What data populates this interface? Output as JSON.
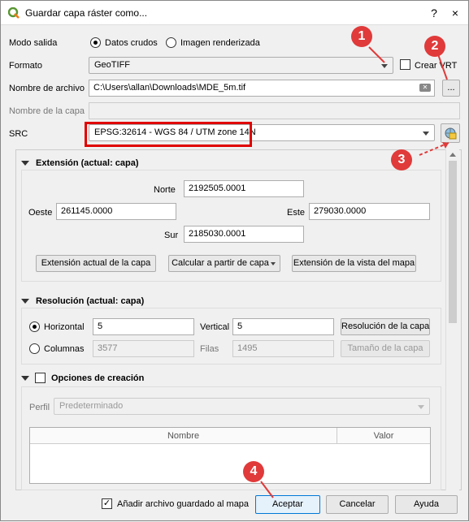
{
  "window": {
    "title": "Guardar capa ráster como...",
    "help_glyph": "?",
    "close_glyph": "×"
  },
  "output_mode": {
    "label": "Modo salida",
    "option1": "Datos crudos",
    "option2": "Imagen renderizada",
    "selected": "Datos crudos"
  },
  "format": {
    "label": "Formato",
    "value": "GeoTIFF",
    "vrt_label": "Crear VRT",
    "vrt_checked": false
  },
  "filename": {
    "label": "Nombre de archivo",
    "value": "C:\\Users\\allan\\Downloads\\MDE_5m.tif",
    "browse_label": "..."
  },
  "layer_name": {
    "label": "Nombre de la capa",
    "value": ""
  },
  "crs": {
    "label": "SRC",
    "value": "EPSG:32614 - WGS 84 / UTM zone 14N"
  },
  "extent": {
    "title": "Extensión (actual: capa)",
    "north_label": "Norte",
    "north": "2192505.0001",
    "west_label": "Oeste",
    "west": "261145.0000",
    "east_label": "Este",
    "east": "279030.0000",
    "south_label": "Sur",
    "south": "2185030.0001",
    "btn_current_layer": "Extensión actual de la capa",
    "btn_calc_from_layer": "Calcular a partir de capa",
    "btn_map_view": "Extensión de la vista del mapa"
  },
  "resolution": {
    "title": "Resolución (actual: capa)",
    "horizontal_label": "Horizontal",
    "horizontal": "5",
    "vertical_label": "Vertical",
    "vertical": "5",
    "btn_layer_resolution": "Resolución de la capa",
    "columns_label": "Columnas",
    "columns": "3577",
    "rows_label": "Filas",
    "rows": "1495",
    "btn_layer_size": "Tamaño de la capa",
    "selected": "Horizontal"
  },
  "creation_options": {
    "title": "Opciones de creación",
    "checked": false,
    "profile_label": "Perfil",
    "profile_value": "Predeterminado",
    "columns": [
      "Nombre",
      "Valor"
    ]
  },
  "footer": {
    "add_to_map_label": "Añadir archivo guardado al mapa",
    "add_to_map_checked": true,
    "ok": "Aceptar",
    "cancel": "Cancelar",
    "help": "Ayuda"
  },
  "annotations": {
    "b1": "1",
    "b2": "2",
    "b3": "3",
    "b4": "4",
    "color": "#e03a3a"
  },
  "colors": {
    "accent": "#0078d7",
    "highlight": "#e00000",
    "qgis_green": "#589632"
  }
}
